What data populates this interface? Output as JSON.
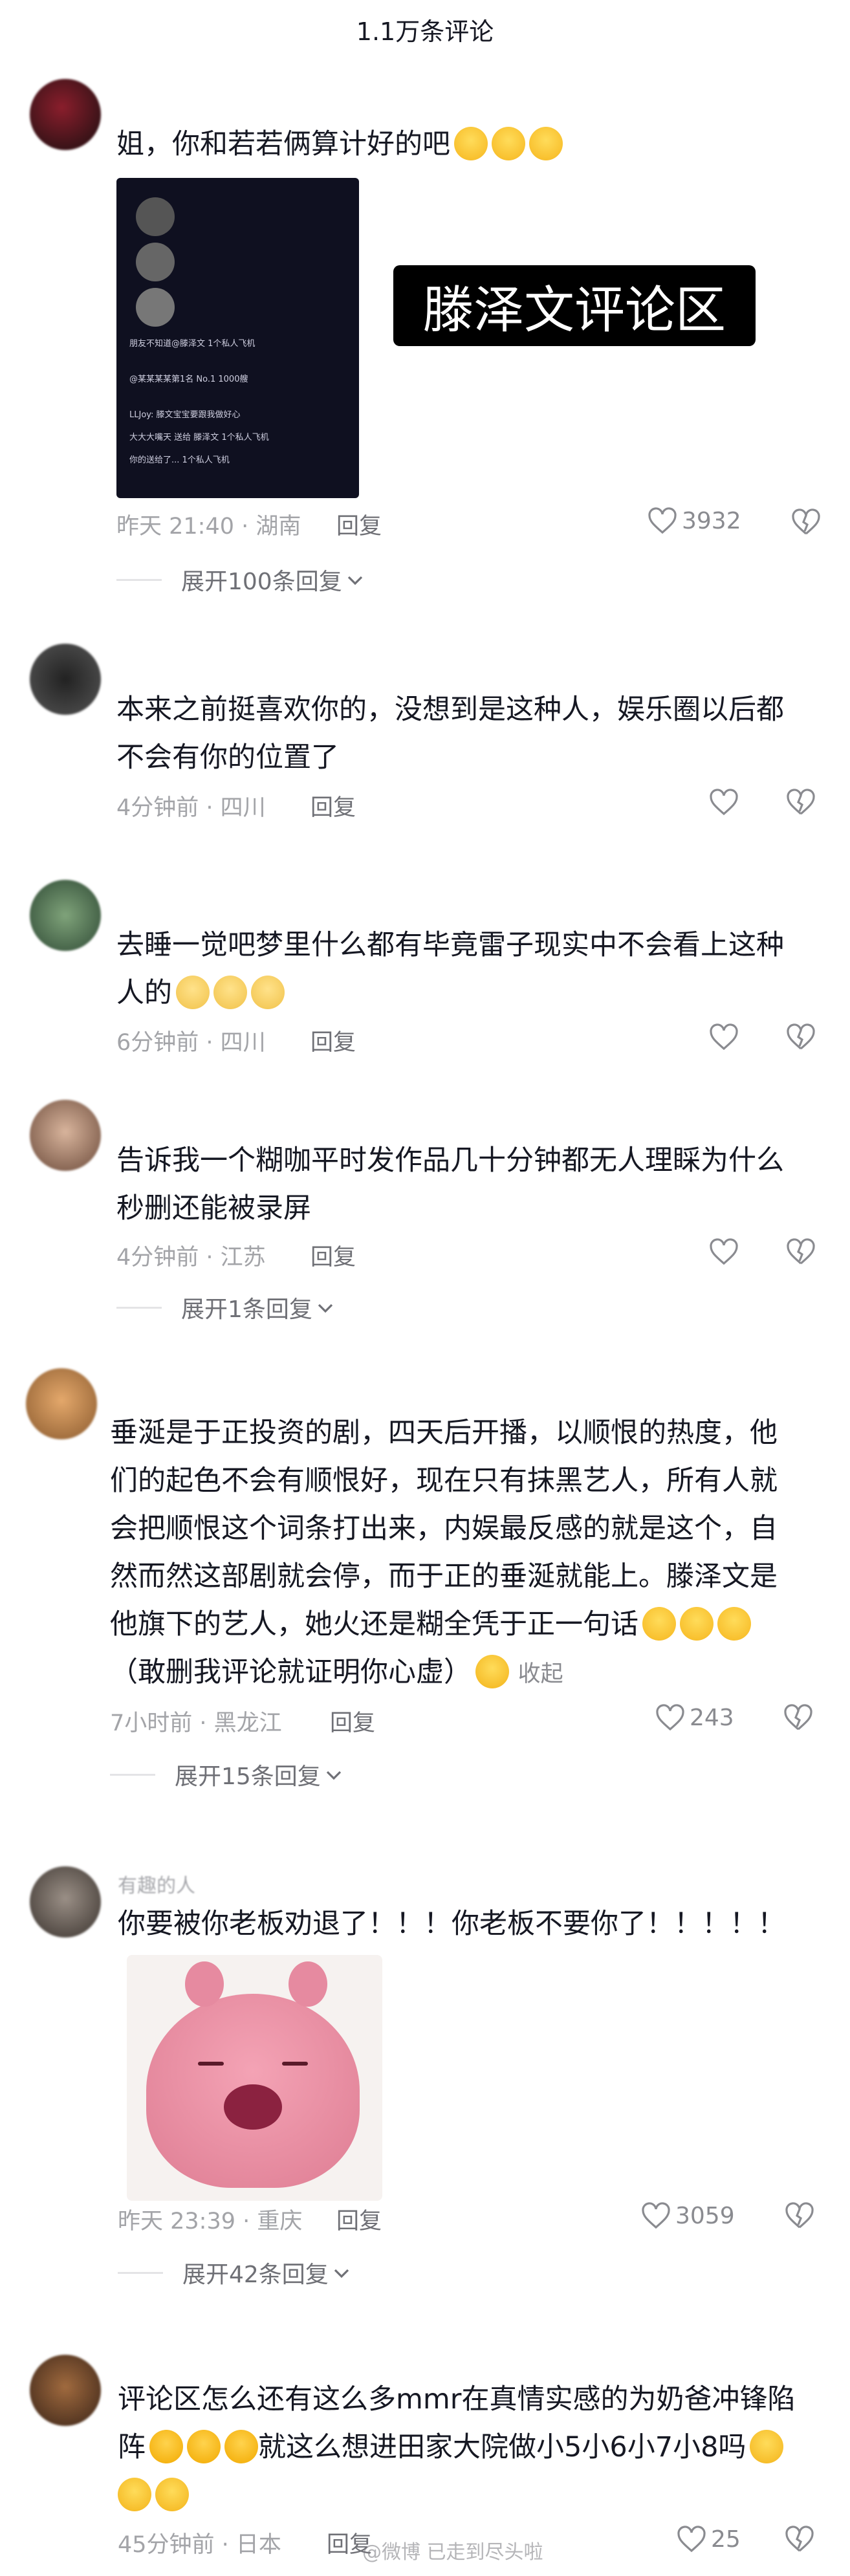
{
  "header": {
    "title": "1.1万条评论"
  },
  "comments": [
    {
      "username": "",
      "text": "姐，你和若若俩算计好的吧",
      "meta": "昨天 21:40 · 湖南",
      "reply": "回复",
      "likes": "3932",
      "expand": "展开100条回复",
      "image_caption": "滕泽文评论区",
      "image_lines": [
        "朋友不知道@滕泽文 1个私人飞机",
        "@某某某某第1名 No.1 1000艘",
        "LLJoy: 滕文宝宝要跟我做好心",
        "大大大嘴天 送给 滕泽文 1个私人飞机",
        "你的送给了... 1个私人飞机"
      ]
    },
    {
      "username": "",
      "text_lines": [
        "本来之前挺喜欢你的，没想到是这种人，娱乐圈以后都",
        "不会有你的位置了"
      ],
      "meta": "4分钟前 · 四川",
      "reply": "回复"
    },
    {
      "username": "",
      "text_lines": [
        "去睡一觉吧梦里什么都有毕竟雷子现实中不会看上这种",
        "人的"
      ],
      "meta": "6分钟前 · 四川",
      "reply": "回复"
    },
    {
      "username": "",
      "text_lines": [
        "告诉我一个糊咖平时发作品几十分钟都无人理睬为什么",
        "秒删还能被录屏"
      ],
      "meta": "4分钟前 · 江苏",
      "reply": "回复",
      "expand": "展开1条回复"
    },
    {
      "username": "",
      "text_lines": [
        "垂涎是于正投资的剧，四天后开播，以顺恨的热度，他",
        "们的起色不会有顺恨好，现在只有抹黑艺人，所有人就",
        "会把顺恨这个词条打出来，内娱最反感的就是这个，自",
        "然而然这部剧就会停，而于正的垂涎就能上。滕泽文是",
        "他旗下的艺人，她火还是糊全凭于正一句话",
        "（敢删我评论就证明你心虚）"
      ],
      "fold": "收起",
      "meta": "7小时前 · 黑龙江",
      "reply": "回复",
      "likes": "243",
      "expand": "展开15条回复"
    },
    {
      "username": "有趣的人",
      "text": "你要被你老板劝退了！！！你老板不要你了！！！！！",
      "meta": "昨天 23:39 · 重庆",
      "reply": "回复",
      "likes": "3059",
      "expand": "展开42条回复"
    },
    {
      "username": "",
      "text_lines": [
        "评论区怎么还有这么多mmr在真情实感的为奶爸冲锋陷",
        "阵",
        "就这么想进田家大院做小5小6小7小8吗"
      ],
      "meta": "45分钟前 · 日本",
      "reply": "回复",
      "likes": "25"
    }
  ],
  "watermark": "@微博 已走到尽头啦",
  "colors": {
    "text": "#161823",
    "meta": "#a3a4a8",
    "divider": "#e4e4e6"
  }
}
